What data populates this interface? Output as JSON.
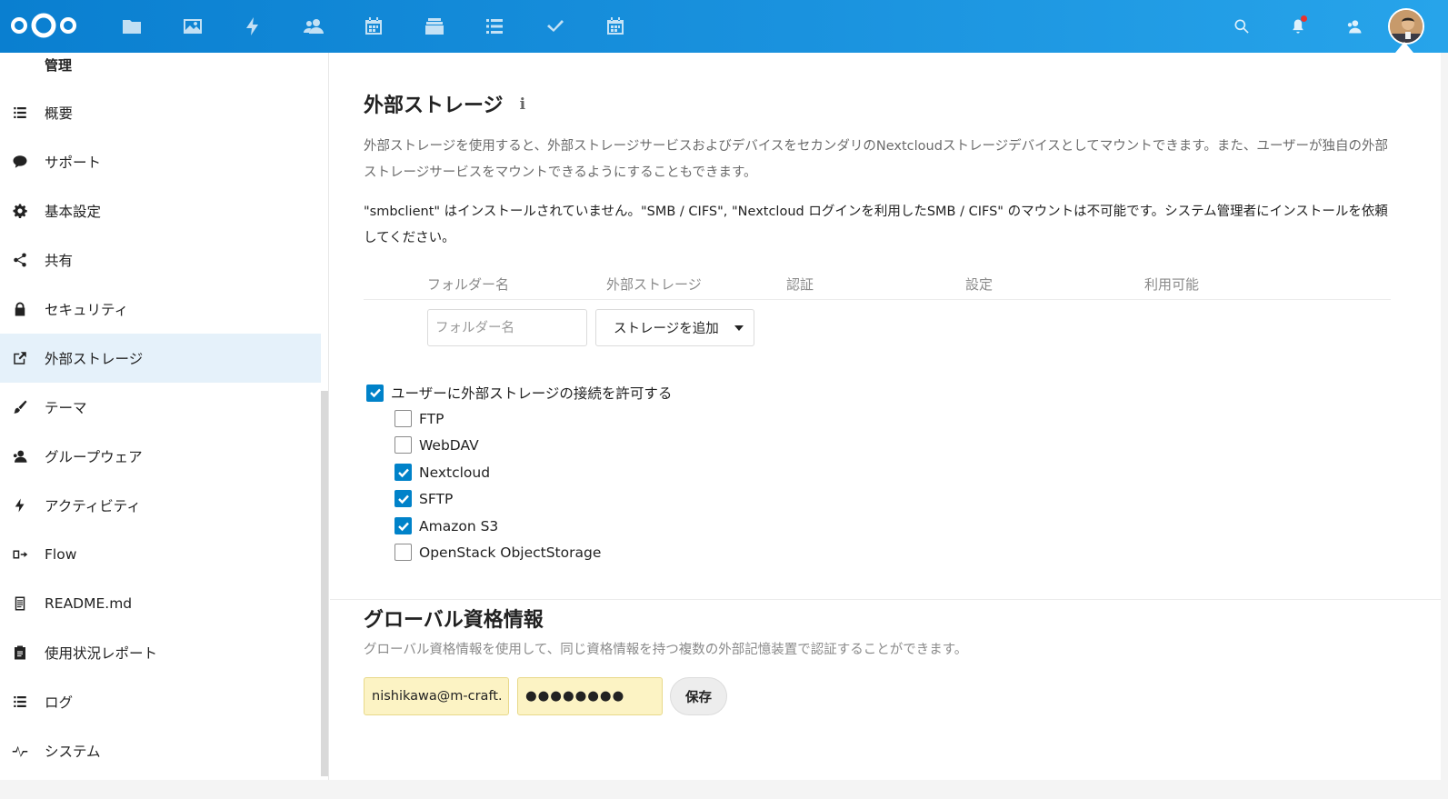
{
  "header": {
    "logo": "nextcloud-logo",
    "apps": [
      {
        "name": "files",
        "icon": "folder-icon"
      },
      {
        "name": "photos",
        "icon": "image-icon"
      },
      {
        "name": "activity",
        "icon": "lightning-icon"
      },
      {
        "name": "contacts",
        "icon": "contacts-icon"
      },
      {
        "name": "calendar",
        "icon": "calendar-icon"
      },
      {
        "name": "deck",
        "icon": "deck-icon"
      },
      {
        "name": "tasks-list",
        "icon": "list-icon"
      },
      {
        "name": "tasks",
        "icon": "checkmark-icon"
      },
      {
        "name": "calendar-2",
        "icon": "calendar-icon"
      }
    ]
  },
  "sidebar": {
    "heading": "管理",
    "items": [
      {
        "label": "概要",
        "icon": "list-icon"
      },
      {
        "label": "サポート",
        "icon": "speech-bubble-icon"
      },
      {
        "label": "基本設定",
        "icon": "gear-icon"
      },
      {
        "label": "共有",
        "icon": "share-icon"
      },
      {
        "label": "セキュリティ",
        "icon": "lock-icon"
      },
      {
        "label": "外部ストレージ",
        "icon": "external-link-icon",
        "active": true
      },
      {
        "label": "テーマ",
        "icon": "brush-icon"
      },
      {
        "label": "グループウェア",
        "icon": "groupware-icon"
      },
      {
        "label": "アクティビティ",
        "icon": "lightning-icon"
      },
      {
        "label": "Flow",
        "icon": "flow-icon"
      },
      {
        "label": "README.md",
        "icon": "document-icon"
      },
      {
        "label": "使用状況レポート",
        "icon": "clipboard-icon"
      },
      {
        "label": "ログ",
        "icon": "list-icon"
      },
      {
        "label": "システム",
        "icon": "pulse-icon"
      }
    ]
  },
  "main": {
    "title": "外部ストレージ",
    "description": "外部ストレージを使用すると、外部ストレージサービスおよびデバイスをセカンダリのNextcloudストレージデバイスとしてマウントできます。また、ユーザーが独自の外部ストレージサービスをマウントできるようにすることもできます。",
    "warning": "\"smbclient\" はインストールされていません。\"SMB / CIFS\", \"Nextcloud ログインを利用したSMB / CIFS\" のマウントは不可能です。システム管理者にインストールを依頼してください。",
    "table_headers": [
      "フォルダー名",
      "外部ストレージ",
      "認証",
      "設定",
      "利用可能"
    ],
    "folder_placeholder": "フォルダー名",
    "add_storage_label": "ストレージを追加",
    "allow_user_mount": {
      "label": "ユーザーに外部ストレージの接続を許可する",
      "checked": true
    },
    "backends": [
      {
        "label": "FTP",
        "checked": false
      },
      {
        "label": "WebDAV",
        "checked": false
      },
      {
        "label": "Nextcloud",
        "checked": true
      },
      {
        "label": "SFTP",
        "checked": true
      },
      {
        "label": "Amazon S3",
        "checked": true
      },
      {
        "label": "OpenStack ObjectStorage",
        "checked": false
      }
    ]
  },
  "global_credentials": {
    "title": "グローバル資格情報",
    "description": "グローバル資格情報を使用して、同じ資格情報を持つ複数の外部記憶装置で認証することができます。",
    "username": "nishikawa@m-craft.c",
    "password": "●●●●●●●●",
    "save_label": "保存"
  },
  "colors": {
    "header_start": "#0a7fd0",
    "header_end": "#27a4ea",
    "accent": "#0082c9",
    "active_bg": "#e5f1fa",
    "credential_bg": "#fcf3c4"
  }
}
